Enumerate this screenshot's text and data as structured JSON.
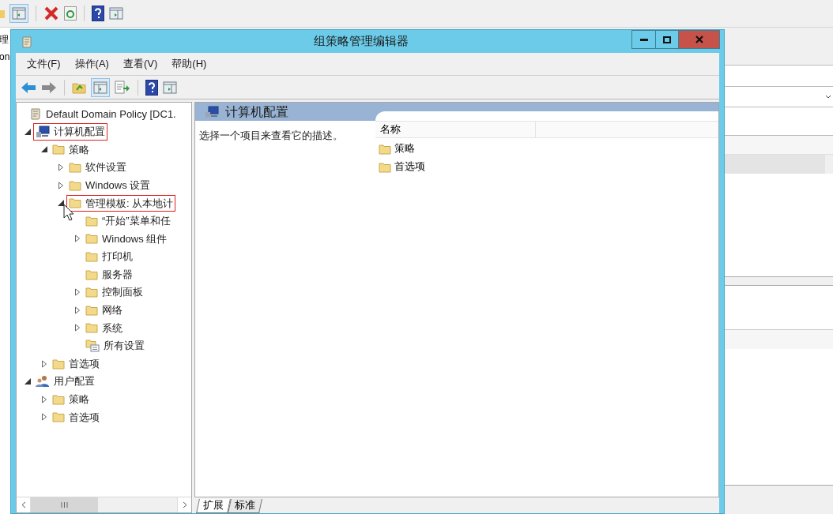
{
  "background_window": {
    "edge_texts": [
      "理",
      "on"
    ]
  },
  "window": {
    "title": "组策略管理编辑器"
  },
  "menu": [
    "文件(F)",
    "操作(A)",
    "查看(V)",
    "帮助(H)"
  ],
  "tree": [
    {
      "label": "Default Domain Policy [DC1.",
      "kind": "policy",
      "highlighted": false,
      "children": [
        {
          "label": "计算机配置",
          "kind": "computer",
          "expanded": true,
          "highlighted": true,
          "children": [
            {
              "label": "策略",
              "kind": "folder",
              "expanded": true,
              "highlighted": false,
              "children": [
                {
                  "label": "软件设置",
                  "kind": "folder",
                  "expanded": false,
                  "highlighted": false
                },
                {
                  "label": "Windows 设置",
                  "kind": "folder",
                  "expanded": false,
                  "highlighted": false
                },
                {
                  "label": "管理模板: 从本地计",
                  "kind": "folder",
                  "expanded": true,
                  "highlighted": true,
                  "children": [
                    {
                      "label": "“开始”菜单和任",
                      "kind": "folder",
                      "highlighted": false
                    },
                    {
                      "label": "Windows 组件",
                      "kind": "folder",
                      "expanded": false,
                      "highlighted": false
                    },
                    {
                      "label": "打印机",
                      "kind": "folder",
                      "highlighted": false
                    },
                    {
                      "label": "服务器",
                      "kind": "folder",
                      "highlighted": false
                    },
                    {
                      "label": "控制面板",
                      "kind": "folder",
                      "expanded": false,
                      "highlighted": false
                    },
                    {
                      "label": "网络",
                      "kind": "folder",
                      "expanded": false,
                      "highlighted": false
                    },
                    {
                      "label": "系统",
                      "kind": "folder",
                      "expanded": false,
                      "highlighted": false
                    },
                    {
                      "label": "所有设置",
                      "kind": "settings",
                      "highlighted": false
                    }
                  ]
                }
              ]
            },
            {
              "label": "首选项",
              "kind": "folder",
              "expanded": false,
              "highlighted": false
            }
          ]
        },
        {
          "label": "用户配置",
          "kind": "user",
          "expanded": true,
          "highlighted": false,
          "children": [
            {
              "label": "策略",
              "kind": "folder",
              "expanded": false,
              "highlighted": false
            },
            {
              "label": "首选项",
              "kind": "folder",
              "expanded": false,
              "highlighted": false
            }
          ]
        }
      ]
    }
  ],
  "detail": {
    "title": "计算机配置",
    "description": "选择一个项目来查看它的描述。",
    "column": "名称",
    "items": [
      "策略",
      "首选项"
    ]
  },
  "tabs": [
    {
      "label": "扩展",
      "selected": true
    },
    {
      "label": "标准",
      "selected": false
    }
  ]
}
